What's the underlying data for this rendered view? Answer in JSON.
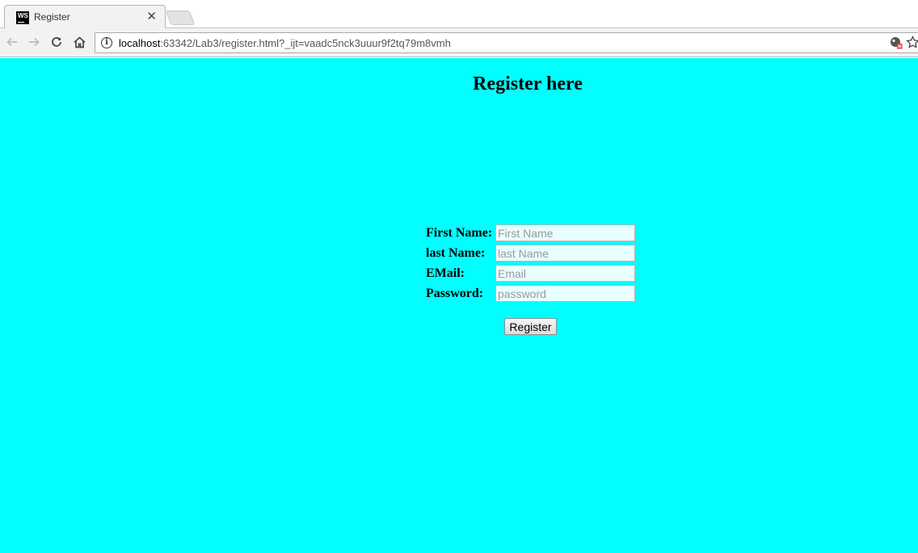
{
  "browser": {
    "tab_title": "Register",
    "tab_favicon_text": "WS",
    "url_host": "localhost",
    "url_rest": ":63342/Lab3/register.html?_ijt=vaadc5nck3uuur9f2tq79m8vmh",
    "icons": [
      "back-icon",
      "forward-icon",
      "reload-icon",
      "home-icon",
      "info-icon",
      "extension-icon",
      "star-icon",
      "close-icon"
    ]
  },
  "page": {
    "background_color": "#00ffff",
    "heading": "Register here",
    "form": {
      "fields": [
        {
          "label": "First Name:",
          "placeholder": "First Name",
          "type": "text"
        },
        {
          "label": "last Name:",
          "placeholder": "last Name",
          "type": "text"
        },
        {
          "label": "EMail:",
          "placeholder": "Email",
          "type": "email"
        },
        {
          "label": "Password:",
          "placeholder": "password",
          "type": "password"
        }
      ],
      "submit_label": "Register"
    }
  }
}
